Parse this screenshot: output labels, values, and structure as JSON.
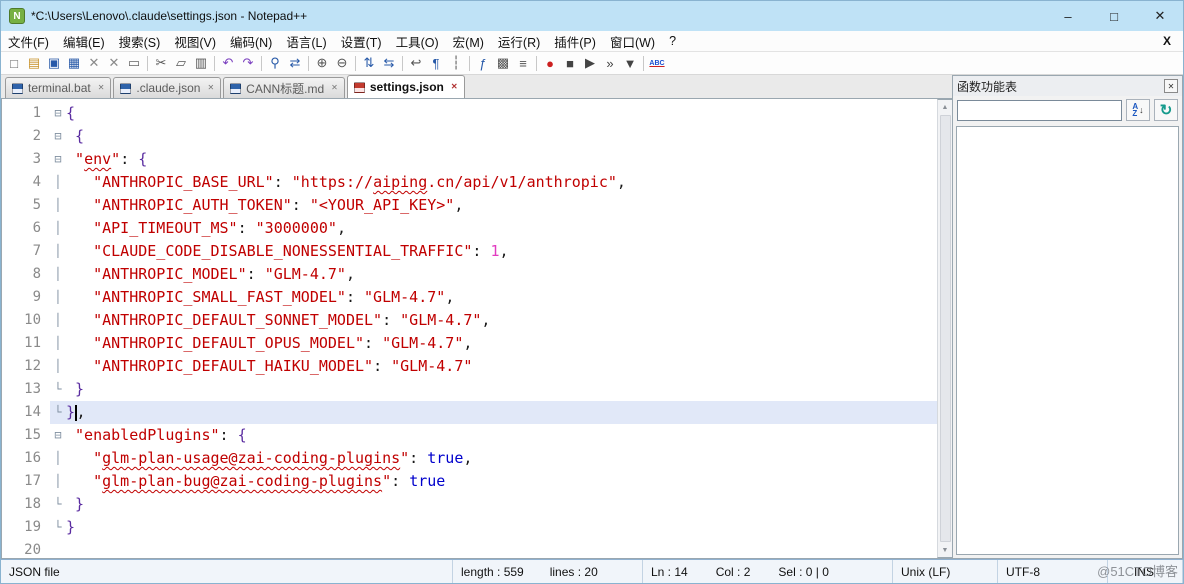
{
  "colors": {
    "brace": "#5a2ca0",
    "key": "#c00000",
    "str": "#c00000",
    "num": "#e23bc0",
    "bool": "#0000cc",
    "plain": "#1a1a1a",
    "active_line_bg": "#e1e8f8",
    "titlebar_bg": "#bfe2f6"
  },
  "window": {
    "title": "*C:\\Users\\Lenovo\\.claude\\settings.json - Notepad++",
    "app_icon_text": "N",
    "minimize": "–",
    "maximize": "□",
    "close": "✕"
  },
  "menu": {
    "items": [
      "文件(F)",
      "编辑(E)",
      "搜索(S)",
      "视图(V)",
      "编码(N)",
      "语言(L)",
      "设置(T)",
      "工具(O)",
      "宏(M)",
      "运行(R)",
      "插件(P)",
      "窗口(W)",
      "?"
    ],
    "close_label": "X"
  },
  "toolbar": {
    "icons": [
      {
        "name": "new-file",
        "glyph": "□",
        "color": "#666"
      },
      {
        "name": "open-folder",
        "glyph": "▤",
        "color": "#c8922a"
      },
      {
        "name": "save",
        "glyph": "▣",
        "color": "#2759a8"
      },
      {
        "name": "save-all",
        "glyph": "▦",
        "color": "#2759a8"
      },
      {
        "name": "close-document",
        "glyph": "✕",
        "color": "#8a8a8a"
      },
      {
        "name": "close-all-documents",
        "glyph": "✕",
        "color": "#8a8a8a"
      },
      {
        "name": "print",
        "glyph": "▭",
        "color": "#666"
      },
      {
        "sep": true
      },
      {
        "name": "cut",
        "glyph": "✂",
        "color": "#555"
      },
      {
        "name": "copy",
        "glyph": "▱",
        "color": "#555"
      },
      {
        "name": "paste",
        "glyph": "▥",
        "color": "#555"
      },
      {
        "sep": true
      },
      {
        "name": "undo",
        "glyph": "↶",
        "color": "#7a3fbf"
      },
      {
        "name": "redo",
        "glyph": "↷",
        "color": "#7a3fbf"
      },
      {
        "sep": true
      },
      {
        "name": "find",
        "glyph": "⚲",
        "color": "#2759a8"
      },
      {
        "name": "replace",
        "glyph": "⇄",
        "color": "#2759a8"
      },
      {
        "sep": true
      },
      {
        "name": "zoom-in",
        "glyph": "⊕",
        "color": "#555"
      },
      {
        "name": "zoom-out",
        "glyph": "⊖",
        "color": "#555"
      },
      {
        "sep": true
      },
      {
        "name": "sync-vertical-scrolling",
        "glyph": "⇅",
        "color": "#2759a8"
      },
      {
        "name": "sync-horizontal-scrolling",
        "glyph": "⇆",
        "color": "#2759a8"
      },
      {
        "sep": true
      },
      {
        "name": "word-wrap",
        "glyph": "↩",
        "color": "#555"
      },
      {
        "name": "show-all-characters",
        "glyph": "¶",
        "color": "#2759a8"
      },
      {
        "name": "indent-guide",
        "glyph": "┆",
        "color": "#555"
      },
      {
        "sep": true
      },
      {
        "name": "function-list",
        "glyph": "ƒ",
        "color": "#2759a8"
      },
      {
        "name": "document-map",
        "glyph": "▩",
        "color": "#555"
      },
      {
        "name": "document-list",
        "glyph": "≡",
        "color": "#555"
      },
      {
        "sep": true
      },
      {
        "name": "macro-record",
        "glyph": "●",
        "color": "#cc2020"
      },
      {
        "name": "macro-stop",
        "glyph": "■",
        "color": "#444"
      },
      {
        "name": "macro-play",
        "glyph": "▶",
        "color": "#444"
      },
      {
        "name": "macro-run-multiple",
        "glyph": "»",
        "color": "#444"
      },
      {
        "name": "macro-save",
        "glyph": "▼",
        "color": "#444"
      },
      {
        "sep": true
      },
      {
        "name": "spell-check",
        "glyph": "ABC",
        "color": "#1a4fd0"
      }
    ]
  },
  "tabs": [
    {
      "label": "terminal.bat",
      "active": false,
      "modified": false
    },
    {
      "label": ".claude.json",
      "active": false,
      "modified": false
    },
    {
      "label": "CANN标题.md",
      "active": false,
      "modified": false
    },
    {
      "label": "settings.json",
      "active": true,
      "modified": true
    }
  ],
  "editor": {
    "lines": [
      {
        "num": 1,
        "fold": "s",
        "ind": 0,
        "tokens": [
          {
            "t": "brace",
            "s": "{"
          }
        ]
      },
      {
        "num": 2,
        "fold": "s",
        "ind": 1,
        "tokens": [
          {
            "t": "brace",
            "s": "{"
          }
        ]
      },
      {
        "num": 3,
        "fold": "s",
        "ind": 1,
        "tokens": [
          {
            "t": "key",
            "s": "\""
          },
          {
            "t": "key",
            "s": "env",
            "u": true
          },
          {
            "t": "key",
            "s": "\""
          },
          {
            "t": "plain",
            "s": ": "
          },
          {
            "t": "brace",
            "s": "{"
          }
        ]
      },
      {
        "num": 4,
        "fold": "l",
        "ind": 3,
        "tokens": [
          {
            "t": "key",
            "s": "\"ANTHROPIC_BASE_URL\""
          },
          {
            "t": "plain",
            "s": ": "
          },
          {
            "t": "str",
            "s": "\"https://"
          },
          {
            "t": "str",
            "s": "aiping",
            "u": true
          },
          {
            "t": "str",
            "s": ".cn/api/v1/anthropic\""
          },
          {
            "t": "plain",
            "s": ","
          }
        ]
      },
      {
        "num": 5,
        "fold": "l",
        "ind": 3,
        "tokens": [
          {
            "t": "key",
            "s": "\"ANTHROPIC_AUTH_TOKEN\""
          },
          {
            "t": "plain",
            "s": ": "
          },
          {
            "t": "str",
            "s": "\"<YOUR_API_KEY>\""
          },
          {
            "t": "plain",
            "s": ","
          }
        ]
      },
      {
        "num": 6,
        "fold": "l",
        "ind": 3,
        "tokens": [
          {
            "t": "key",
            "s": "\"API_TIMEOUT_MS\""
          },
          {
            "t": "plain",
            "s": ": "
          },
          {
            "t": "str",
            "s": "\"3000000\""
          },
          {
            "t": "plain",
            "s": ","
          }
        ]
      },
      {
        "num": 7,
        "fold": "l",
        "ind": 3,
        "tokens": [
          {
            "t": "key",
            "s": "\"CLAUDE_CODE_DISABLE_NONESSENTIAL_TRAFFIC\""
          },
          {
            "t": "plain",
            "s": ": "
          },
          {
            "t": "num",
            "s": "1"
          },
          {
            "t": "plain",
            "s": ","
          }
        ]
      },
      {
        "num": 8,
        "fold": "l",
        "ind": 3,
        "tokens": [
          {
            "t": "key",
            "s": "\"ANTHROPIC_MODEL\""
          },
          {
            "t": "plain",
            "s": ": "
          },
          {
            "t": "str",
            "s": "\"GLM-4.7\""
          },
          {
            "t": "plain",
            "s": ","
          }
        ]
      },
      {
        "num": 9,
        "fold": "l",
        "ind": 3,
        "tokens": [
          {
            "t": "key",
            "s": "\"ANTHROPIC_SMALL_FAST_MODEL\""
          },
          {
            "t": "plain",
            "s": ": "
          },
          {
            "t": "str",
            "s": "\"GLM-4.7\""
          },
          {
            "t": "plain",
            "s": ","
          }
        ]
      },
      {
        "num": 10,
        "fold": "l",
        "ind": 3,
        "tokens": [
          {
            "t": "key",
            "s": "\"ANTHROPIC_DEFAULT_SONNET_MODEL\""
          },
          {
            "t": "plain",
            "s": ": "
          },
          {
            "t": "str",
            "s": "\"GLM-4.7\""
          },
          {
            "t": "plain",
            "s": ","
          }
        ]
      },
      {
        "num": 11,
        "fold": "l",
        "ind": 3,
        "tokens": [
          {
            "t": "key",
            "s": "\"ANTHROPIC_DEFAULT_OPUS_MODEL\""
          },
          {
            "t": "plain",
            "s": ": "
          },
          {
            "t": "str",
            "s": "\"GLM-4.7\""
          },
          {
            "t": "plain",
            "s": ","
          }
        ]
      },
      {
        "num": 12,
        "fold": "l",
        "ind": 3,
        "tokens": [
          {
            "t": "key",
            "s": "\"ANTHROPIC_DEFAULT_HAIKU_MODEL\""
          },
          {
            "t": "plain",
            "s": ": "
          },
          {
            "t": "str",
            "s": "\"GLM-4.7\""
          }
        ]
      },
      {
        "num": 13,
        "fold": "e",
        "ind": 1,
        "tokens": [
          {
            "t": "brace",
            "s": "}"
          }
        ]
      },
      {
        "num": 14,
        "fold": "e",
        "ind": 0,
        "hl": true,
        "tokens": [
          {
            "t": "brace",
            "s": "}"
          },
          {
            "t": "caret"
          },
          {
            "t": "plain",
            "s": ","
          }
        ]
      },
      {
        "num": 15,
        "fold": "s",
        "ind": 1,
        "tokens": [
          {
            "t": "key",
            "s": "\"enabledPlugins\""
          },
          {
            "t": "plain",
            "s": ": "
          },
          {
            "t": "brace",
            "s": "{"
          }
        ]
      },
      {
        "num": 16,
        "fold": "l",
        "ind": 3,
        "tokens": [
          {
            "t": "key",
            "s": "\""
          },
          {
            "t": "key",
            "s": "glm-plan-usage@zai-coding-plugins",
            "u": true
          },
          {
            "t": "key",
            "s": "\""
          },
          {
            "t": "plain",
            "s": ": "
          },
          {
            "t": "bool",
            "s": "true"
          },
          {
            "t": "plain",
            "s": ","
          }
        ]
      },
      {
        "num": 17,
        "fold": "l",
        "ind": 3,
        "tokens": [
          {
            "t": "key",
            "s": "\""
          },
          {
            "t": "key",
            "s": "glm-plan-bug@zai-coding-plugins",
            "u": true
          },
          {
            "t": "key",
            "s": "\""
          },
          {
            "t": "plain",
            "s": ": "
          },
          {
            "t": "bool",
            "s": "true"
          }
        ]
      },
      {
        "num": 18,
        "fold": "e",
        "ind": 1,
        "tokens": [
          {
            "t": "brace",
            "s": "}"
          }
        ]
      },
      {
        "num": 19,
        "fold": "e",
        "ind": 0,
        "tokens": [
          {
            "t": "brace",
            "s": "}"
          }
        ]
      },
      {
        "num": 20,
        "fold": "n",
        "ind": 0,
        "tokens": []
      }
    ]
  },
  "scrollbar": {
    "up": "▲",
    "down": "▼"
  },
  "function_panel": {
    "title": "函数功能表",
    "close_label": "✕",
    "search_value": "",
    "sort_a": "A",
    "sort_z": "Z",
    "sort_arrow": "↓",
    "refresh_glyph": "↻"
  },
  "statusbar": {
    "doc_type": "JSON file",
    "length": "length : 559",
    "lines": "lines : 20",
    "ln": "Ln : 14",
    "col": "Col : 2",
    "sel": "Sel : 0 | 0",
    "eol": "Unix (LF)",
    "encoding": "UTF-8",
    "ins": "INS"
  },
  "watermark": "@51CTO博客"
}
